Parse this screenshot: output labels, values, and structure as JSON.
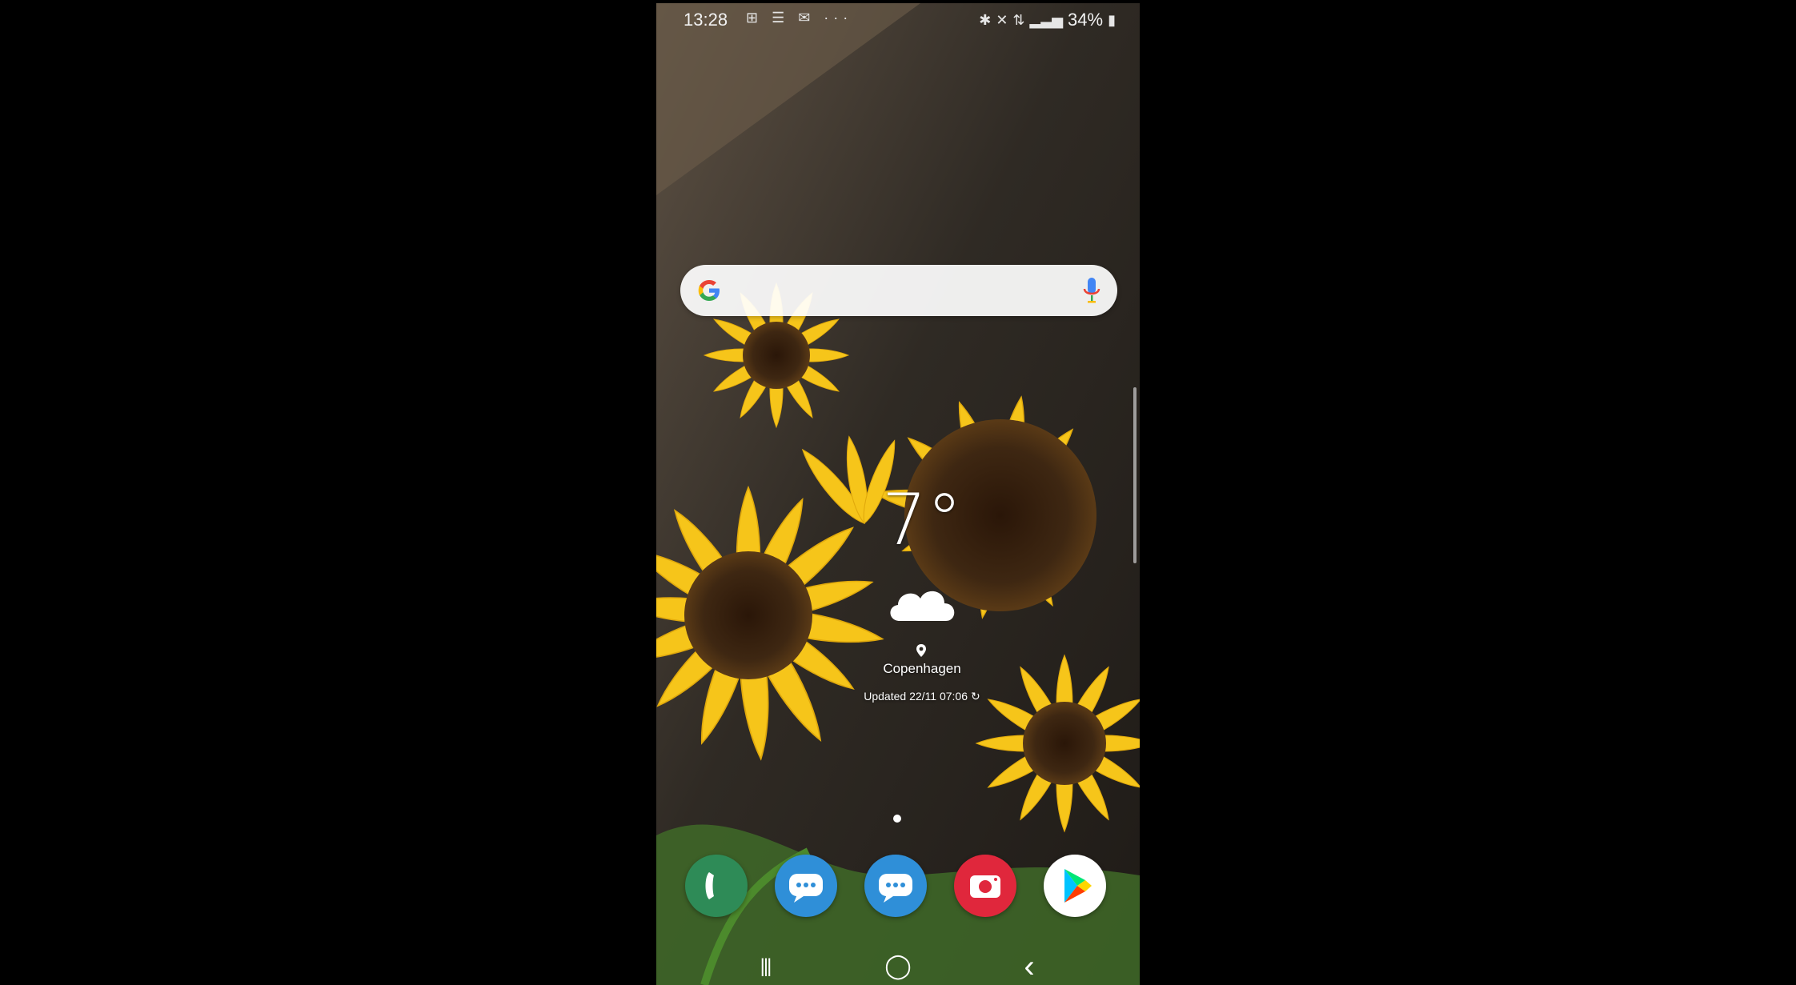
{
  "status_bar": {
    "time": "13:28",
    "left_icons": "⊞ ☰ ✉ ···",
    "battery": "34%",
    "icons": [
      "bluetooth-icon",
      "mute-icon",
      "4g-icon",
      "signal-icon",
      "battery-icon"
    ]
  },
  "search": {
    "provider_logo": "G",
    "icons": [
      "google-logo-icon",
      "mic-icon"
    ]
  },
  "weather": {
    "temperature": "7°",
    "condition_icon": "cloud-icon",
    "location": "Copenhagen",
    "updated": "Updated 22/11 07:06"
  },
  "dock": {
    "apps": [
      {
        "name": "Phone",
        "icon": "phone-icon",
        "color": "#2e8b57"
      },
      {
        "name": "Messages",
        "icon": "chat-icon",
        "color": "#2f8fd8"
      },
      {
        "name": "Messages",
        "icon": "chat-icon",
        "color": "#2f8fd8"
      },
      {
        "name": "Camera",
        "icon": "camera-icon",
        "color": "#e0273c"
      },
      {
        "name": "Play Store",
        "icon": "play-store-icon",
        "color": "#ffffff"
      }
    ]
  },
  "nav_bar": {
    "recents": "|||",
    "home": "◯",
    "back": "‹"
  },
  "colors": {
    "petal": "#f5c518",
    "center": "#3a2412",
    "background": "#2e2a24"
  }
}
